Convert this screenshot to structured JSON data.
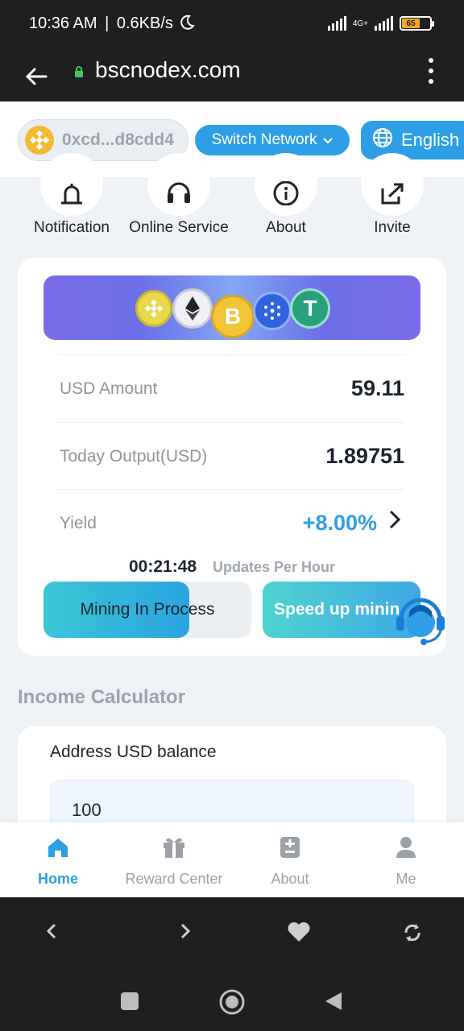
{
  "status": {
    "time": "10:36 AM",
    "speed": "0.6KB/s",
    "network": "4G+",
    "battery": "65"
  },
  "browser": {
    "url": "bscnodex.com"
  },
  "header": {
    "wallet_address": "0xcd...d8cdd4",
    "switch_network_label": "Switch Network",
    "language_label": "English"
  },
  "quick_actions": [
    {
      "label": "Notification",
      "icon": "bell-icon"
    },
    {
      "label": "Online Service",
      "icon": "headset-icon"
    },
    {
      "label": "About",
      "icon": "info-icon"
    },
    {
      "label": "Invite",
      "icon": "share-icon"
    }
  ],
  "mining_card": {
    "usd_amount_label": "USD Amount",
    "usd_amount_value": "59.11",
    "today_output_label": "Today Output(USD)",
    "today_output_value": "1.89751",
    "yield_label": "Yield",
    "yield_value": "+8.00%",
    "timer": "00:21:48",
    "timer_note": "Updates Per Hour",
    "mining_label": "Mining In Process",
    "mining_progress": 0.7,
    "speed_label": "Speed up minin"
  },
  "calculator": {
    "title": "Income Calculator",
    "balance_label": "Address USD balance",
    "balance_value": "100"
  },
  "tabs": [
    {
      "label": "Home",
      "icon": "home-icon",
      "active": true
    },
    {
      "label": "Reward Center",
      "icon": "gift-icon",
      "active": false
    },
    {
      "label": "About",
      "icon": "document-icon",
      "active": false
    },
    {
      "label": "Me",
      "icon": "user-icon",
      "active": false
    }
  ],
  "colors": {
    "accent": "#2e9fe6",
    "page_bg": "#eef2f6",
    "system_bar": "#1f1f1f"
  }
}
